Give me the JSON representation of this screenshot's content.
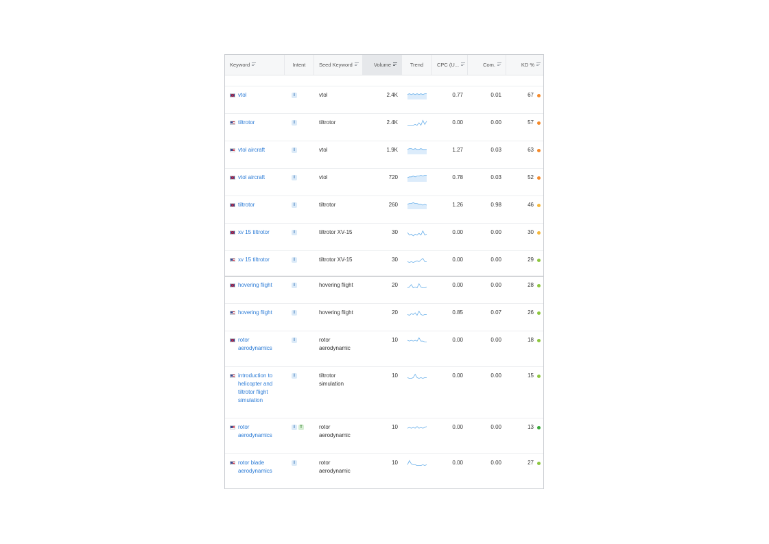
{
  "headers": {
    "keyword": "Keyword",
    "intent": "Intent",
    "seed": "Seed Keyword",
    "volume": "Volume",
    "trend": "Trend",
    "cpc": "CPC (U...",
    "com": "Com.",
    "kd": "KD %"
  },
  "colors": {
    "keyword_link": "#2b7bd6",
    "kd_orange": "#f58a2b",
    "kd_yellow": "#f5b83d",
    "kd_green": "#8dc63f",
    "kd_dark_green": "#3aa83a",
    "trend_line": "#6ab0ea",
    "trend_fill": "#dcecfb"
  },
  "rows": [
    {
      "flag": "gb",
      "keyword_lines": [
        "vtol"
      ],
      "intents": [
        "I"
      ],
      "seed_lines": [
        "vtol"
      ],
      "volume": "2.4K",
      "trend": [
        6,
        7,
        6,
        7,
        6,
        7,
        6,
        7,
        6,
        7,
        7
      ],
      "trend_fill": true,
      "cpc": "0.77",
      "com": "0.01",
      "kd": "67",
      "kd_color": "orange"
    },
    {
      "flag": "us",
      "keyword_lines": [
        "tiltrotor"
      ],
      "intents": [
        "I"
      ],
      "seed_lines": [
        "tiltrotor"
      ],
      "volume": "2.4K",
      "trend": [
        2,
        2,
        2,
        2,
        3,
        2,
        5,
        2,
        8,
        3,
        7
      ],
      "trend_fill": false,
      "cpc": "0.00",
      "com": "0.00",
      "kd": "57",
      "kd_color": "orange"
    },
    {
      "flag": "us",
      "keyword_lines": [
        "vtol aircraft"
      ],
      "intents": [
        "I"
      ],
      "seed_lines": [
        "vtol"
      ],
      "volume": "1.9K",
      "trend": [
        6,
        7,
        7,
        6,
        7,
        6,
        6,
        7,
        6,
        6,
        6
      ],
      "trend_fill": true,
      "cpc": "1.27",
      "com": "0.03",
      "kd": "63",
      "kd_color": "orange"
    },
    {
      "flag": "gb",
      "keyword_lines": [
        "vtol aircraft"
      ],
      "intents": [
        "I"
      ],
      "seed_lines": [
        "vtol"
      ],
      "volume": "720",
      "trend": [
        5,
        6,
        6,
        7,
        6,
        7,
        7,
        8,
        7,
        8,
        8
      ],
      "trend_fill": true,
      "cpc": "0.78",
      "com": "0.03",
      "kd": "52",
      "kd_color": "orange"
    },
    {
      "flag": "gb",
      "keyword_lines": [
        "tiltrotor"
      ],
      "intents": [
        "I"
      ],
      "seed_lines": [
        "tiltrotor"
      ],
      "volume": "260",
      "trend": [
        6,
        7,
        7,
        8,
        7,
        7,
        6,
        6,
        5,
        6,
        5
      ],
      "trend_fill": true,
      "cpc": "1.26",
      "com": "0.98",
      "kd": "46",
      "kd_color": "yellow"
    },
    {
      "flag": "gb",
      "keyword_lines": [
        "xv 15 tiltrotor"
      ],
      "intents": [
        "I"
      ],
      "seed_lines": [
        "tiltrotor XV-15"
      ],
      "volume": "30",
      "trend": [
        5,
        2,
        3,
        1,
        3,
        2,
        4,
        2,
        7,
        2,
        3
      ],
      "trend_fill": false,
      "cpc": "0.00",
      "com": "0.00",
      "kd": "30",
      "kd_color": "yellow"
    },
    {
      "flag": "us",
      "keyword_lines": [
        "xv 15 tiltrotor"
      ],
      "intents": [
        "I"
      ],
      "seed_lines": [
        "tiltrotor XV-15"
      ],
      "volume": "30",
      "trend": [
        3,
        2,
        3,
        2,
        3,
        4,
        3,
        5,
        7,
        3,
        3
      ],
      "trend_fill": false,
      "cpc": "0.00",
      "com": "0.00",
      "kd": "29",
      "kd_color": "green"
    },
    {
      "flag": "gb",
      "keyword_lines": [
        "hovering flight"
      ],
      "intents": [
        "I"
      ],
      "seed_lines": [
        "hovering flight"
      ],
      "volume": "20",
      "trend": [
        2,
        3,
        6,
        2,
        3,
        2,
        7,
        3,
        2,
        2,
        3
      ],
      "trend_fill": false,
      "cpc": "0.00",
      "com": "0.00",
      "kd": "28",
      "kd_color": "green"
    },
    {
      "flag": "us",
      "keyword_lines": [
        "hovering flight"
      ],
      "intents": [
        "I"
      ],
      "seed_lines": [
        "hovering flight"
      ],
      "volume": "20",
      "trend": [
        3,
        2,
        4,
        3,
        5,
        2,
        7,
        3,
        2,
        3,
        3
      ],
      "trend_fill": false,
      "cpc": "0.85",
      "com": "0.07",
      "kd": "26",
      "kd_color": "green"
    },
    {
      "flag": "gb",
      "keyword_lines": [
        "rotor",
        "aerodynamics"
      ],
      "intents": [
        "I"
      ],
      "seed_lines": [
        "rotor",
        "aerodynamic"
      ],
      "volume": "10",
      "trend": [
        5,
        4,
        5,
        4,
        5,
        4,
        8,
        4,
        4,
        3,
        3
      ],
      "trend_fill": false,
      "cpc": "0.00",
      "com": "0.00",
      "kd": "18",
      "kd_color": "green"
    },
    {
      "flag": "us",
      "keyword_lines": [
        "introduction to",
        "helicopter and",
        "tiltrotor flight",
        "simulation"
      ],
      "intents": [
        "I"
      ],
      "seed_lines": [
        "tiltrotor",
        "simulation"
      ],
      "volume": "10",
      "trend": [
        3,
        2,
        2,
        3,
        7,
        3,
        2,
        3,
        2,
        3,
        3
      ],
      "trend_fill": false,
      "cpc": "0.00",
      "com": "0.00",
      "kd": "15",
      "kd_color": "green"
    },
    {
      "flag": "us",
      "keyword_lines": [
        "rotor",
        "aerodynamics"
      ],
      "intents": [
        "I",
        "T"
      ],
      "seed_lines": [
        "rotor",
        "aerodynamic"
      ],
      "volume": "10",
      "trend": [
        4,
        5,
        4,
        5,
        4,
        6,
        4,
        5,
        4,
        5,
        6
      ],
      "trend_fill": false,
      "cpc": "0.00",
      "com": "0.00",
      "kd": "13",
      "kd_color": "dark_green"
    },
    {
      "flag": "us",
      "keyword_lines": [
        "rotor blade",
        "aerodynamics"
      ],
      "intents": [
        "I"
      ],
      "seed_lines": [
        "rotor",
        "aerodynamic"
      ],
      "volume": "10",
      "trend": [
        3,
        8,
        4,
        3,
        3,
        2,
        2,
        2,
        3,
        2,
        3
      ],
      "trend_fill": false,
      "cpc": "0.00",
      "com": "0.00",
      "kd": "27",
      "kd_color": "green"
    }
  ]
}
